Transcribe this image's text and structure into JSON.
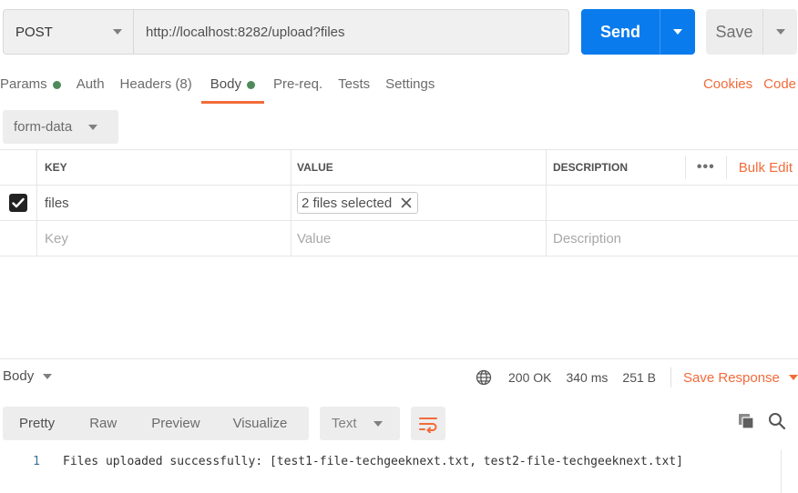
{
  "request": {
    "method": "POST",
    "url": "http://localhost:8282/upload?files",
    "send_label": "Send",
    "save_label": "Save"
  },
  "tabs": [
    {
      "label": "Params",
      "dot": true
    },
    {
      "label": "Auth",
      "dot": false
    },
    {
      "label": "Headers (8)",
      "dot": false
    },
    {
      "label": "Body",
      "dot": true,
      "active": true
    },
    {
      "label": "Pre-req.",
      "dot": false
    },
    {
      "label": "Tests",
      "dot": false
    },
    {
      "label": "Settings",
      "dot": false
    }
  ],
  "links": {
    "cookies": "Cookies",
    "code": "Code"
  },
  "body_type": "form-data",
  "params_table": {
    "headers": {
      "key": "KEY",
      "value": "VALUE",
      "description": "DESCRIPTION"
    },
    "more": "•••",
    "bulk_edit": "Bulk Edit",
    "rows": [
      {
        "checked": true,
        "key": "files",
        "value": "2 files selected",
        "description": ""
      }
    ],
    "placeholders": {
      "key": "Key",
      "value": "Value",
      "description": "Description"
    }
  },
  "response": {
    "body_label": "Body",
    "status": "200 OK",
    "time": "340 ms",
    "size": "251 B",
    "save_response": "Save Response",
    "view_tabs": [
      "Pretty",
      "Raw",
      "Preview",
      "Visualize"
    ],
    "active_view": "Pretty",
    "format": "Text",
    "lines": [
      {
        "no": "1",
        "text": "Files uploaded successfully: [test1-file-techgeeknext.txt, test2-file-techgeeknext.txt]"
      }
    ]
  },
  "colors": {
    "accent": "#f26b3a",
    "send": "#097bed",
    "dot": "#4f8a5b"
  }
}
